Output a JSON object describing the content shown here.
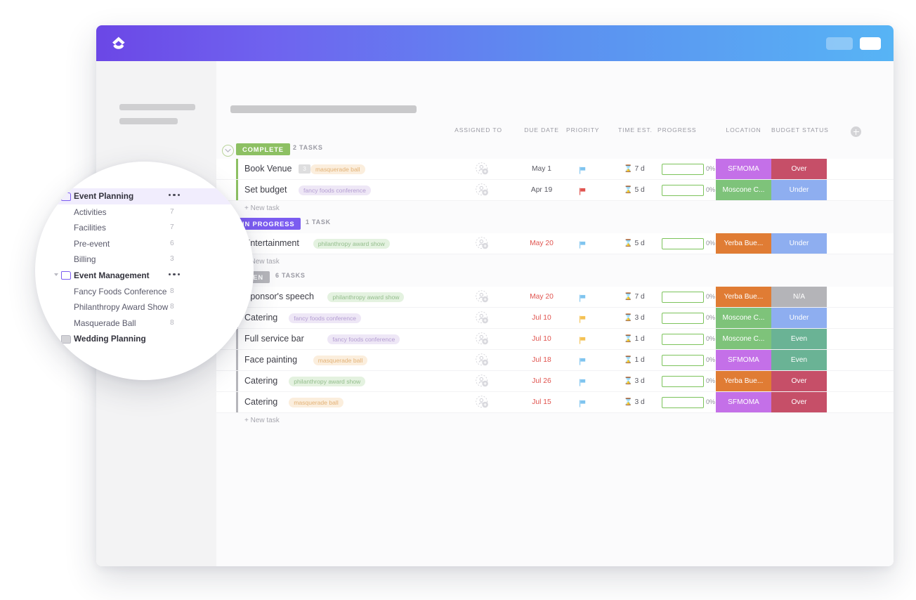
{
  "window": {
    "logo_icon": "clickup-logo-icon",
    "titlebar_pill_a": "",
    "titlebar_pill_b": ""
  },
  "sidebar": {
    "search_placeholder": "",
    "chat_icon": "chat-bubble-icon"
  },
  "main": {
    "columns": [
      {
        "key": "assigned_to",
        "label": "ASSIGNED TO"
      },
      {
        "key": "due_date",
        "label": "DUE DATE"
      },
      {
        "key": "priority",
        "label": "PRIORITY"
      },
      {
        "key": "time_est",
        "label": "TIME EST."
      },
      {
        "key": "progress",
        "label": "PROGRESS"
      },
      {
        "key": "location",
        "label": "LOCATION"
      },
      {
        "key": "budget_status",
        "label": "BUDGET STATUS"
      }
    ],
    "add_column_label": "+",
    "new_task_label": "+ New task",
    "groups": [
      {
        "status": "COMPLETE",
        "status_color": "#8dc063",
        "count_label": "2 TASKS",
        "tasks": [
          {
            "name": "Book Venue",
            "badge": "3",
            "tag": "masquerade ball",
            "tag_bg": "#fbeedd",
            "tag_fg": "#e3b276",
            "due": "May 1",
            "due_red": false,
            "priority": "blue",
            "time": "7 d",
            "progress": "0%",
            "location": "SFMOMA",
            "location_bg": "#c470e8",
            "budget": "Over",
            "budget_bg": "#c64f68"
          },
          {
            "name": "Set budget",
            "badge": "",
            "tag": "fancy foods conference",
            "tag_bg": "#eee7f6",
            "tag_fg": "#b49ed2",
            "due": "Apr 19",
            "due_red": false,
            "priority": "red",
            "time": "5 d",
            "progress": "0%",
            "location": "Moscone C...",
            "location_bg": "#7ec37a",
            "budget": "Under",
            "budget_bg": "#8eaef0"
          }
        ]
      },
      {
        "status": "IN PROGRESS",
        "status_color": "#7b5cf0",
        "count_label": "1 TASK",
        "tasks": [
          {
            "name": "Entertainment",
            "badge": "",
            "tag": "philanthropy award show",
            "tag_bg": "#e4f2e0",
            "tag_fg": "#93bd8c",
            "due": "May 20",
            "due_red": true,
            "priority": "blue",
            "time": "5 d",
            "progress": "0%",
            "location": "Yerba Bue...",
            "location_bg": "#e07c34",
            "budget": "Under",
            "budget_bg": "#8eaef0"
          }
        ]
      },
      {
        "status": "OPEN",
        "status_color": "#b6b6bb",
        "count_label": "6 TASKS",
        "tasks": [
          {
            "name": "Sponsor's speech",
            "badge": "",
            "tag": "philanthropy award show",
            "tag_bg": "#e4f2e0",
            "tag_fg": "#93bd8c",
            "due": "May 20",
            "due_red": true,
            "priority": "blue",
            "time": "7 d",
            "progress": "0%",
            "location": "Yerba Bue...",
            "location_bg": "#e07c34",
            "budget": "N/A",
            "budget_bg": "#b4b4b8"
          },
          {
            "name": "Catering",
            "badge": "",
            "tag": "fancy foods conference",
            "tag_bg": "#eee7f6",
            "tag_fg": "#b49ed2",
            "due": "Jul 10",
            "due_red": true,
            "priority": "yellow",
            "time": "3 d",
            "progress": "0%",
            "location": "Moscone C...",
            "location_bg": "#7ec37a",
            "budget": "Under",
            "budget_bg": "#8eaef0"
          },
          {
            "name": "Full service bar",
            "badge": "",
            "tag": "fancy foods conference",
            "tag_bg": "#eee7f6",
            "tag_fg": "#b49ed2",
            "due": "Jul 10",
            "due_red": true,
            "priority": "yellow",
            "time": "1 d",
            "progress": "0%",
            "location": "Moscone C...",
            "location_bg": "#7ec37a",
            "budget": "Even",
            "budget_bg": "#6ab395"
          },
          {
            "name": "Face painting",
            "badge": "",
            "tag": "masquerade ball",
            "tag_bg": "#fbeedd",
            "tag_fg": "#e3b276",
            "due": "Jul 18",
            "due_red": true,
            "priority": "blue",
            "time": "1 d",
            "progress": "0%",
            "location": "SFMOMA",
            "location_bg": "#c470e8",
            "budget": "Even",
            "budget_bg": "#6ab395"
          },
          {
            "name": "Catering",
            "badge": "",
            "tag": "philanthropy award show",
            "tag_bg": "#e4f2e0",
            "tag_fg": "#93bd8c",
            "due": "Jul 26",
            "due_red": true,
            "priority": "blue",
            "time": "3 d",
            "progress": "0%",
            "location": "Yerba Bue...",
            "location_bg": "#e07c34",
            "budget": "Over",
            "budget_bg": "#c64f68"
          },
          {
            "name": "Catering",
            "badge": "",
            "tag": "masquerade ball",
            "tag_bg": "#fbeedd",
            "tag_fg": "#e3b276",
            "due": "Jul 15",
            "due_red": true,
            "priority": "blue",
            "time": "3 d",
            "progress": "0%",
            "location": "SFMOMA",
            "location_bg": "#c470e8",
            "budget": "Over",
            "budget_bg": "#c64f68"
          }
        ]
      }
    ]
  },
  "magnifier": {
    "items": [
      {
        "label": "Event Planning",
        "type": "folder",
        "expanded": true,
        "highlight": true,
        "count": "",
        "menu": true
      },
      {
        "label": "Activities",
        "type": "list",
        "expanded": false,
        "highlight": false,
        "count": "7",
        "menu": false
      },
      {
        "label": "Facilities",
        "type": "list",
        "expanded": false,
        "highlight": false,
        "count": "7",
        "menu": false
      },
      {
        "label": "Pre-event",
        "type": "list",
        "expanded": false,
        "highlight": false,
        "count": "6",
        "menu": false
      },
      {
        "label": "Billing",
        "type": "list",
        "expanded": false,
        "highlight": false,
        "count": "3",
        "menu": false
      },
      {
        "label": "Event Management",
        "type": "folder",
        "expanded": true,
        "highlight": false,
        "count": "",
        "menu": true
      },
      {
        "label": "Fancy Foods Conference",
        "type": "list",
        "expanded": false,
        "highlight": false,
        "count": "8",
        "menu": false
      },
      {
        "label": "Philanthropy Award Show",
        "type": "list",
        "expanded": false,
        "highlight": false,
        "count": "8",
        "menu": false
      },
      {
        "label": "Masquerade Ball",
        "type": "list",
        "expanded": false,
        "highlight": false,
        "count": "8",
        "menu": false
      },
      {
        "label": "Wedding Planning",
        "type": "folder-collapsed",
        "expanded": false,
        "highlight": false,
        "count": "",
        "menu": false
      }
    ]
  }
}
